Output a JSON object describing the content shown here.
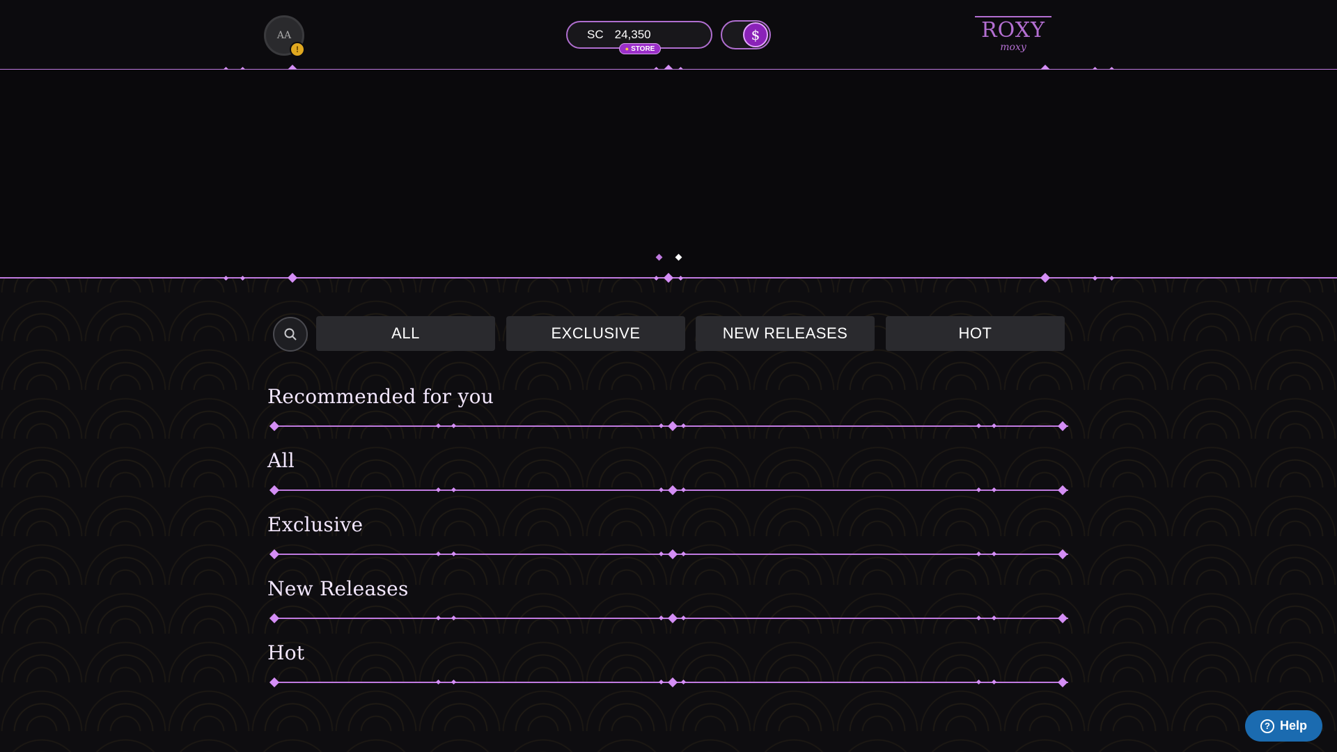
{
  "header": {
    "avatar_initials": "AA",
    "avatar_badge": "!",
    "currency_code": "SC",
    "balance": "24,350",
    "store_label": "STORE",
    "toggle_symbol": "$",
    "logo_text": "ROXY",
    "logo_sub": "moxy"
  },
  "banner": {
    "carousel_dots": 2,
    "active_dot": 1
  },
  "filters": {
    "search_icon": "search-icon",
    "tabs": [
      {
        "label": "ALL"
      },
      {
        "label": "EXCLUSIVE"
      },
      {
        "label": "NEW RELEASES"
      },
      {
        "label": "HOT"
      }
    ]
  },
  "sections": [
    {
      "title": "Recommended for you"
    },
    {
      "title": "All"
    },
    {
      "title": "Exclusive"
    },
    {
      "title": "New Releases"
    },
    {
      "title": "Hot"
    }
  ],
  "help": {
    "label": "Help",
    "icon": "?"
  },
  "colors": {
    "accent": "#c07ae0",
    "help": "#1b6bb0",
    "background": "#0e0d10"
  }
}
